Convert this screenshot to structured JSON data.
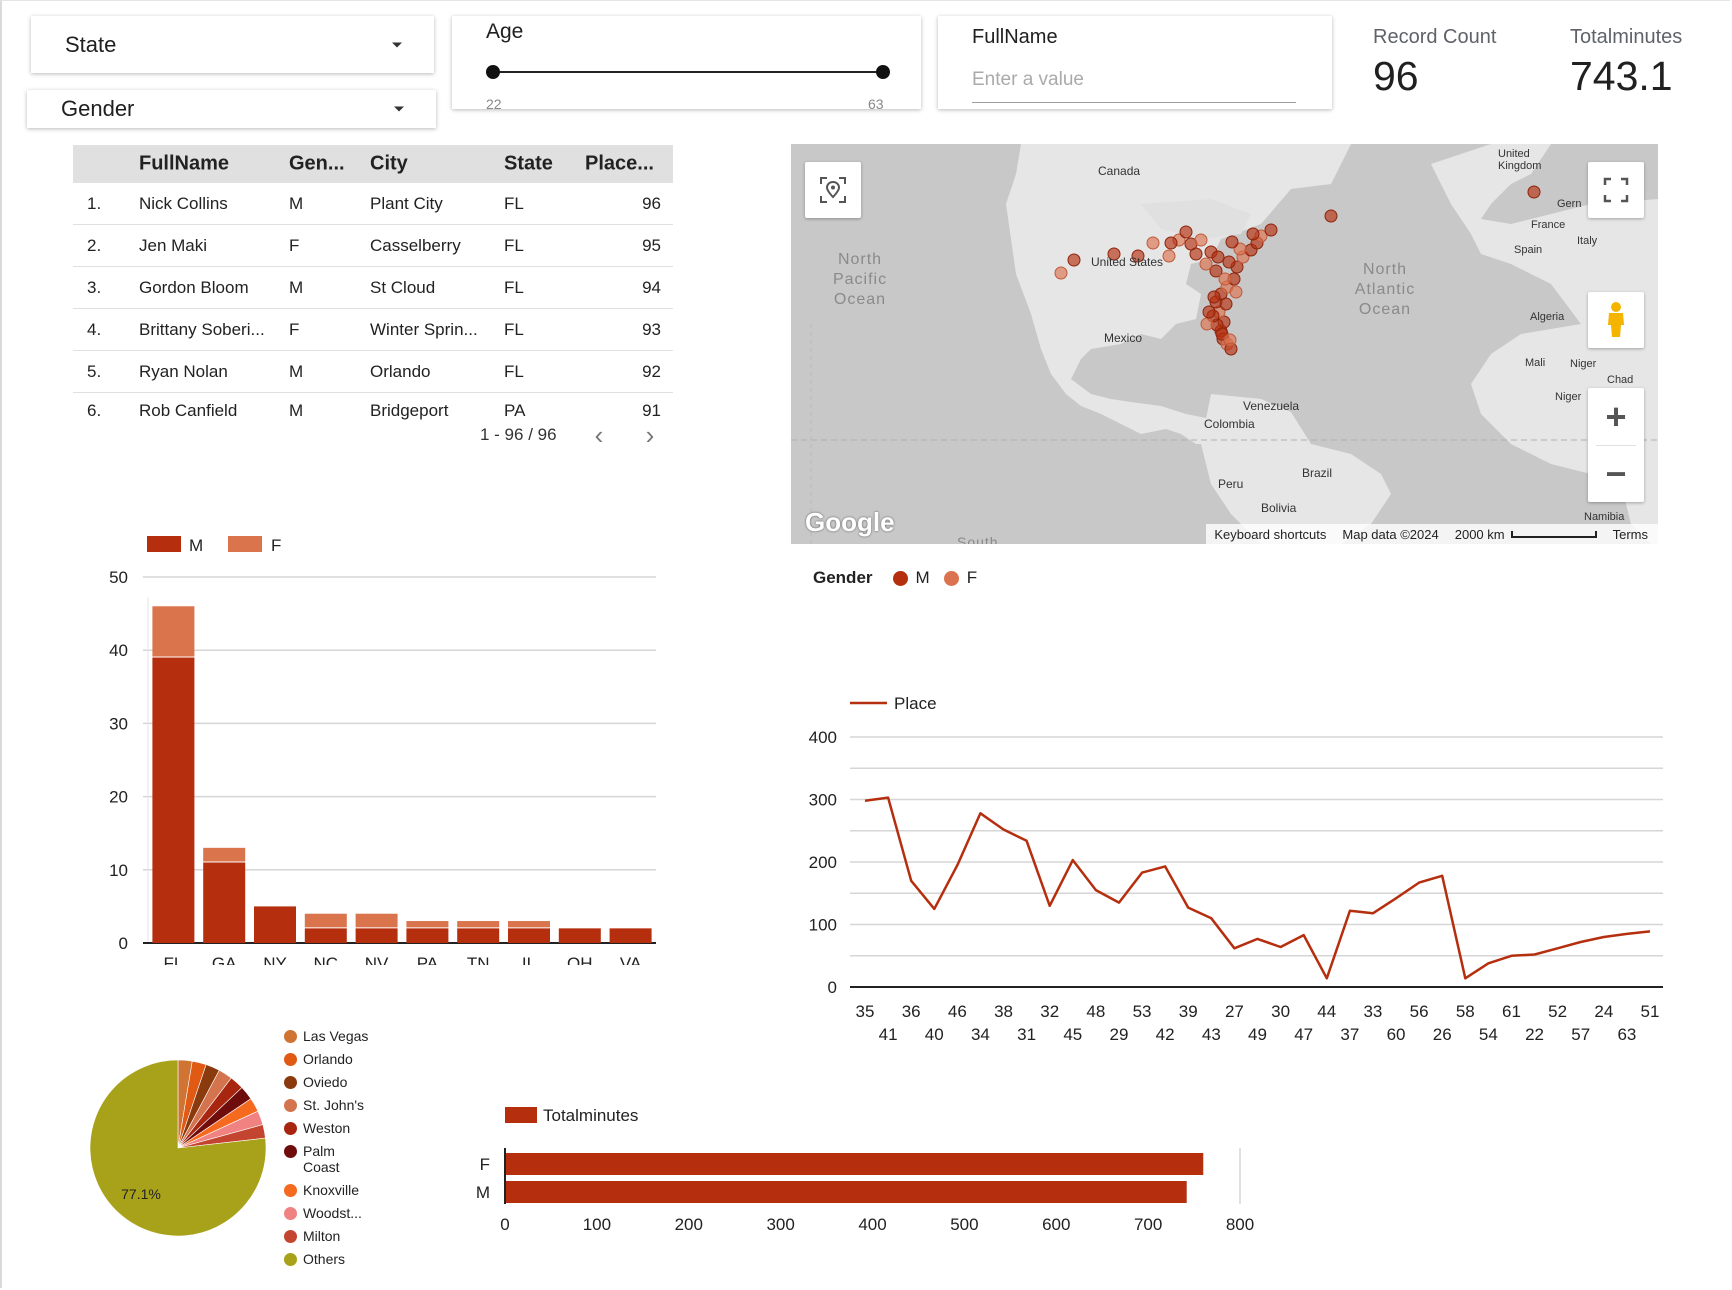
{
  "filters": {
    "state_label": "State",
    "gender_label": "Gender",
    "age": {
      "label": "Age",
      "min": "22",
      "max": "63"
    },
    "fullname": {
      "label": "FullName",
      "placeholder": "Enter a value"
    }
  },
  "scorecards": {
    "record_count": {
      "label": "Record Count",
      "value": "96"
    },
    "totalminutes": {
      "label": "Totalminutes",
      "value": "743.1"
    }
  },
  "table": {
    "headers": [
      "FullName",
      "Gen...",
      "City",
      "State",
      "Place..."
    ],
    "rows": [
      {
        "idx": "1.",
        "name": "Nick Collins",
        "gender": "M",
        "city": "Plant City",
        "state": "FL",
        "place": "96"
      },
      {
        "idx": "2.",
        "name": "Jen Maki",
        "gender": "F",
        "city": "Casselberry",
        "state": "FL",
        "place": "95"
      },
      {
        "idx": "3.",
        "name": "Gordon Bloom",
        "gender": "M",
        "city": "St Cloud",
        "state": "FL",
        "place": "94"
      },
      {
        "idx": "4.",
        "name": "Brittany Soberi...",
        "gender": "F",
        "city": "Winter Sprin...",
        "state": "FL",
        "place": "93"
      },
      {
        "idx": "5.",
        "name": "Ryan Nolan",
        "gender": "M",
        "city": "Orlando",
        "state": "FL",
        "place": "92"
      },
      {
        "idx": "6.",
        "name": "Rob Canfield",
        "gender": "M",
        "city": "Bridgeport",
        "state": "PA",
        "place": "91"
      }
    ],
    "pagination": "1 - 96 / 96"
  },
  "map": {
    "labels": {
      "canada": "Canada",
      "us": "United States",
      "mexico": "Mexico",
      "npo": "North Pacific Ocean",
      "nao": "North Atlantic Ocean",
      "venezuela": "Venezuela",
      "colombia": "Colombia",
      "peru": "Peru",
      "brazil": "Brazil",
      "bolivia": "Bolivia",
      "uk": "United Kingdom",
      "france": "France",
      "spain": "Spain",
      "italy": "Italy",
      "germany": "Gern",
      "algeria": "Algeria",
      "mali": "Mali",
      "niger": "Niger",
      "chad": "Chad",
      "nigeria": "Niger",
      "namibia": "Namibia",
      "south": "South"
    },
    "footer": {
      "shortcuts": "Keyboard shortcuts",
      "data": "Map data ©2024",
      "scale": "2000 km",
      "terms": "Terms"
    },
    "logo": "Google",
    "zoom_in": "+",
    "zoom_out": "−",
    "legend": {
      "title": "Gender",
      "m": "M",
      "f": "F"
    },
    "colors": {
      "m": "#b52f0f",
      "f": "#db7350"
    }
  },
  "colors": {
    "male": "#b52f0f",
    "female": "#d9744d",
    "pie_others": "#a8a21a"
  },
  "chart_data": [
    {
      "type": "bar",
      "stacked": true,
      "categories": [
        "FL",
        "GA",
        "NY",
        "NC",
        "NV",
        "PA",
        "TN",
        "IL",
        "OH",
        "VA"
      ],
      "series": [
        {
          "name": "M",
          "values": [
            39,
            11,
            5,
            2,
            2,
            2,
            2,
            2,
            2,
            2
          ]
        },
        {
          "name": "F",
          "values": [
            7,
            2,
            0,
            2,
            2,
            1,
            1,
            1,
            0,
            0
          ]
        }
      ],
      "ylim": [
        0,
        50
      ],
      "yticks": [
        "0",
        "10",
        "20",
        "30",
        "40",
        "50"
      ],
      "legend": "top-left"
    },
    {
      "type": "line",
      "series": [
        {
          "name": "Place",
          "values": [
            298,
            303,
            170,
            125,
            195,
            278,
            252,
            234,
            130,
            203,
            155,
            135,
            183,
            193,
            127,
            110,
            62,
            77,
            64,
            83,
            14,
            122,
            118,
            142,
            167,
            178,
            14,
            38,
            50,
            52,
            62,
            72,
            80,
            85,
            89
          ]
        }
      ],
      "x_top": [
        "35",
        "36",
        "46",
        "38",
        "32",
        "48",
        "53",
        "39",
        "27",
        "30",
        "44",
        "33",
        "56",
        "58",
        "61",
        "52",
        "24",
        "51"
      ],
      "x_bottom": [
        "41",
        "40",
        "34",
        "31",
        "45",
        "29",
        "42",
        "43",
        "49",
        "47",
        "37",
        "60",
        "26",
        "54",
        "22",
        "57",
        "63"
      ],
      "ylim": [
        0,
        400
      ],
      "yticks": [
        "0",
        "100",
        "200",
        "300",
        "400"
      ],
      "legend": "top-left"
    },
    {
      "type": "pie",
      "slices": [
        {
          "label": "Las Vegas",
          "value": 2.6,
          "color": "#cf7433"
        },
        {
          "label": "Orlando",
          "value": 2.6,
          "color": "#e05a14"
        },
        {
          "label": "Oviedo",
          "value": 2.6,
          "color": "#8a3a0c"
        },
        {
          "label": "St. John's",
          "value": 2.6,
          "color": "#d4744f"
        },
        {
          "label": "Weston",
          "value": 2.6,
          "color": "#a8260f"
        },
        {
          "label": "Palm Coast",
          "value": 2.6,
          "color": "#6f0c0c"
        },
        {
          "label": "Knoxville",
          "value": 2.6,
          "color": "#f56a1e"
        },
        {
          "label": "Woodst...",
          "value": 2.6,
          "color": "#f08282"
        },
        {
          "label": "Milton",
          "value": 2.5,
          "color": "#c4452f"
        },
        {
          "label": "Others",
          "value": 77.1,
          "color": "#a8a21a"
        }
      ],
      "center_label": "77.1%"
    },
    {
      "type": "bar",
      "orientation": "horizontal",
      "categories": [
        "F",
        "M"
      ],
      "series": [
        {
          "name": "Totalminutes",
          "values": [
            760,
            742
          ]
        }
      ],
      "xlim": [
        0,
        800
      ],
      "xticks": [
        "0",
        "100",
        "200",
        "300",
        "400",
        "500",
        "600",
        "700",
        "800"
      ],
      "legend": "top-left"
    }
  ]
}
